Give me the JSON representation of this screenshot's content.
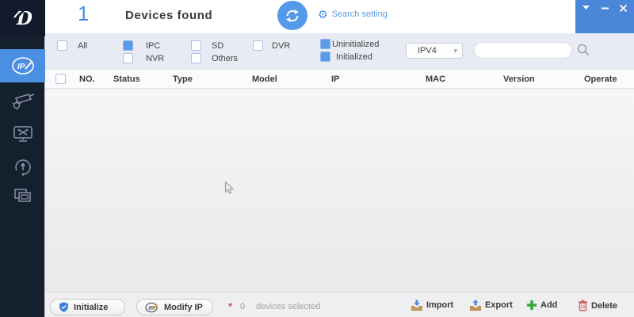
{
  "window": {
    "controls": {
      "menu": "chevron-down",
      "minimize": "minus",
      "close": "x"
    }
  },
  "sidebar": {
    "items": [
      {
        "icon": "ip-pencil-icon",
        "active": true
      },
      {
        "icon": "camera-gear-icon",
        "active": false
      },
      {
        "icon": "monitor-tools-icon",
        "active": false
      },
      {
        "icon": "upgrade-arrow-icon",
        "active": false
      },
      {
        "icon": "layered-windows-icon",
        "active": false
      }
    ]
  },
  "header": {
    "device_count": "1",
    "title": "Devices found",
    "refresh_icon": "refresh-icon",
    "gear_icon": "⚙",
    "search_setting_label": "Search setting"
  },
  "filters": {
    "items": [
      {
        "label": "All",
        "checked": false
      },
      {
        "label": "IPC",
        "checked": true
      },
      {
        "label": "NVR",
        "checked": false
      },
      {
        "label": "SD",
        "checked": false
      },
      {
        "label": "Others",
        "checked": false
      },
      {
        "label": "DVR",
        "checked": false
      },
      {
        "label": "Uninitialized",
        "checked": true
      },
      {
        "label": "Initialized",
        "checked": true
      }
    ],
    "ip_version_selected": "IPV4",
    "ip_version_chevron": "▾",
    "search_value": "",
    "search_placeholder": ""
  },
  "table": {
    "select_all_checked": false,
    "columns": [
      "NO.",
      "Status",
      "Type",
      "Model",
      "IP",
      "MAC",
      "Version",
      "Operate"
    ],
    "rows": []
  },
  "footer": {
    "initialize_label": "Initialize",
    "modify_ip_label": "Modify IP",
    "selected_star": "*",
    "selected_count": "0",
    "selected_label": "devices selected",
    "import_label": "Import",
    "export_label": "Export",
    "add_label": "Add",
    "delete_label": "Delete"
  },
  "colors": {
    "accent_blue": "#4a90e2",
    "titlebar_blue": "#4b87d9",
    "sidebar_bg": "#15202f",
    "filterbar_bg": "#e9ebf4",
    "add_green": "#3aa53a",
    "delete_red": "#cc5555",
    "import_tray_tan": "#c89858"
  }
}
